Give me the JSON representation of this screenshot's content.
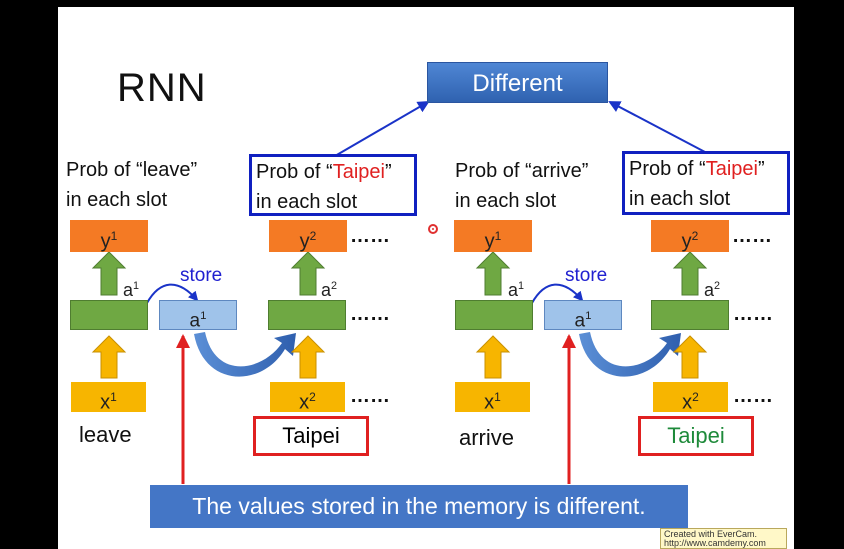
{
  "title": "RNN",
  "top_box": "Different",
  "left": {
    "prob_line1": "Prob of “leave”",
    "prob_line2": "in each slot",
    "y1": "y",
    "a1_label": "a",
    "store": "store",
    "mem": "a",
    "x1": "x",
    "word1": "leave",
    "prob2_pre": "Prob of “",
    "prob2_city": "Taipei",
    "prob2_post": "”",
    "prob2_line2": "in each slot",
    "y2": "y",
    "a2_label": "a",
    "x2": "x",
    "word2": "Taipei"
  },
  "right": {
    "prob_line1": "Prob of “arrive”",
    "prob_line2": "in each slot",
    "y1": "y",
    "a1_label": "a",
    "store": "store",
    "mem": "a",
    "x1": "x",
    "word1": "arrive",
    "prob2_pre": "Prob of “",
    "prob2_city": "Taipei",
    "prob2_post": "”",
    "prob2_line2": "in each slot",
    "y2": "y",
    "a2_label": "a",
    "x2": "x",
    "word2": "Taipei"
  },
  "sup1": "1",
  "sup2": "2",
  "dots": "……",
  "banner": "The values stored in the memory is different.",
  "watermark_line1": "Created with EverCam.",
  "watermark_line2": "http://www.camdemy.com",
  "colors": {
    "output": "#f47a24",
    "input": "#f7b500",
    "hidden": "#6fa843",
    "memory": "#9fc3ea",
    "banner": "#4476c6",
    "highlight_box": "#1020c0",
    "word_box": "#e02020",
    "green_word": "#1e8a3a"
  }
}
